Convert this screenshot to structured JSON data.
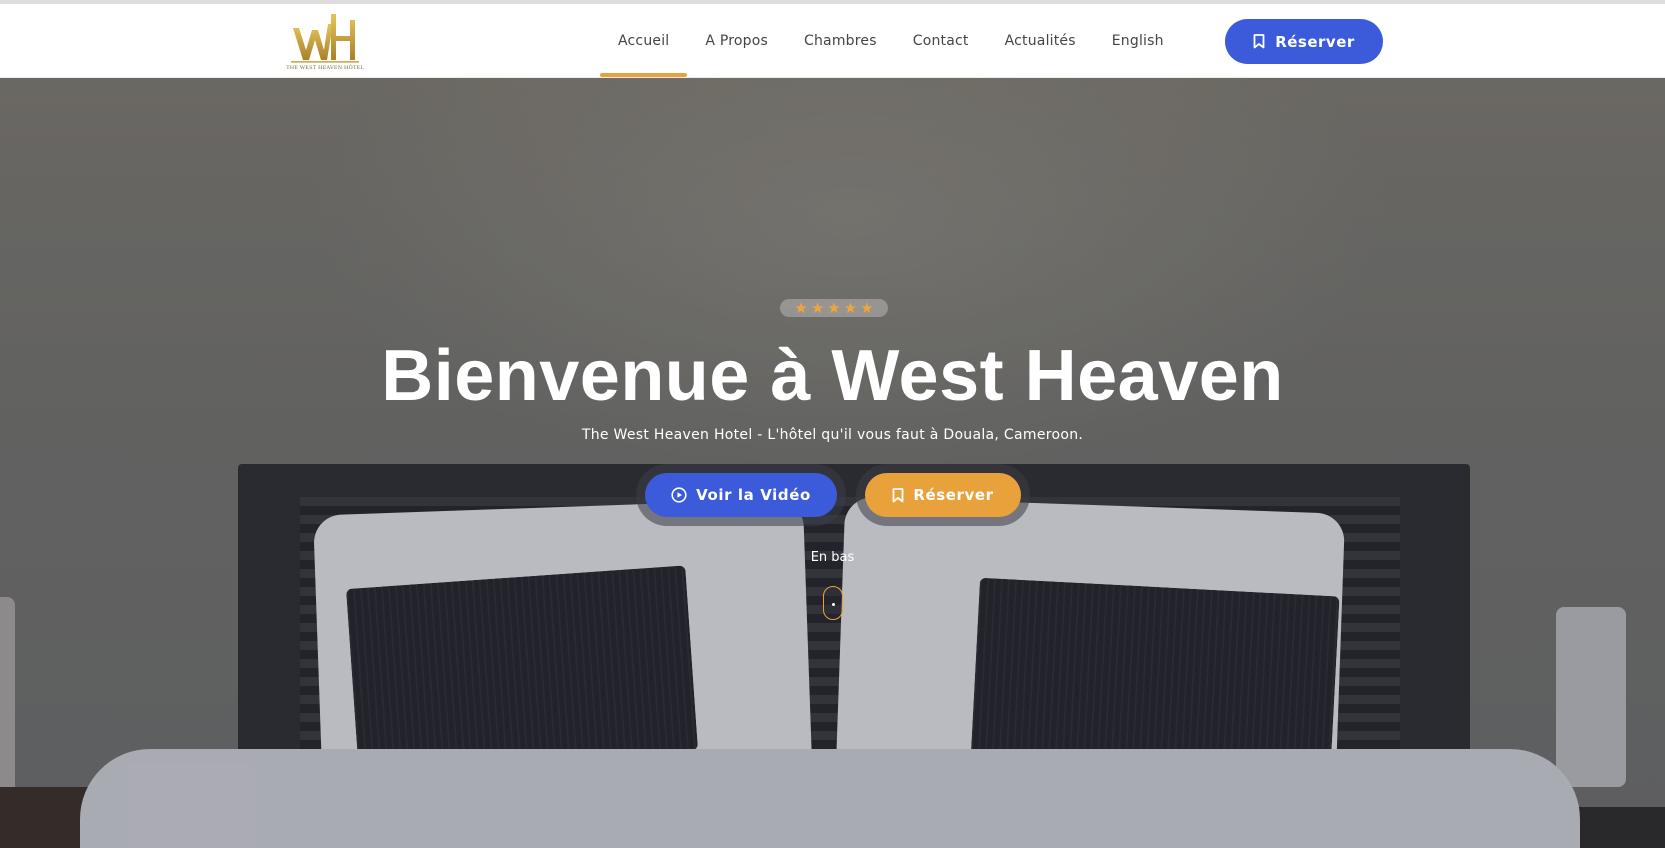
{
  "brand": {
    "logo_text": "THE WEST HEAVEN HÔTEL",
    "logo_color": "#c9a43a"
  },
  "nav": {
    "items": [
      {
        "label": "Accueil",
        "active": true
      },
      {
        "label": "A Propos",
        "active": false
      },
      {
        "label": "Chambres",
        "active": false
      },
      {
        "label": "Contact",
        "active": false
      },
      {
        "label": "Actualités",
        "active": false
      },
      {
        "label": "English",
        "active": false
      }
    ],
    "cta": {
      "label": "Réserver",
      "icon": "bookmark-icon"
    }
  },
  "hero": {
    "rating_stars": 5,
    "title": "Bienvenue à West Heaven",
    "subtitle": "The West Heaven Hotel - L'hôtel qu'il vous faut à Douala, Cameroon.",
    "buttons": {
      "video": {
        "label": "Voir la Vidéo",
        "icon": "play-circle-icon"
      },
      "book": {
        "label": "Réserver",
        "icon": "bookmark-icon"
      }
    },
    "scroll_label": "En bas"
  },
  "colors": {
    "primary": "#3b5bdb",
    "accent": "#e9a23b",
    "nav_text": "#454545"
  }
}
